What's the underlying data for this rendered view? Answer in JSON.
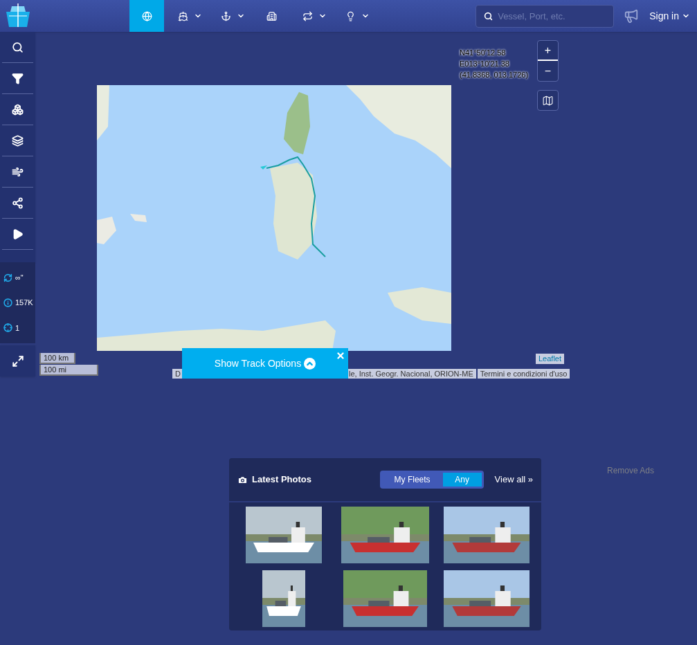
{
  "nav": {
    "tabs": [
      {
        "kind": "globe",
        "selected": true,
        "dropdown": false
      },
      {
        "kind": "ship",
        "selected": false,
        "dropdown": true
      },
      {
        "kind": "anchor",
        "selected": false,
        "dropdown": true
      },
      {
        "kind": "building",
        "selected": false,
        "dropdown": false
      },
      {
        "kind": "repeat",
        "selected": false,
        "dropdown": true
      },
      {
        "kind": "bulb",
        "selected": false,
        "dropdown": true
      }
    ]
  },
  "search": {
    "placeholder": "Vessel, Port, etc."
  },
  "sign_in": "Sign in",
  "sidebar": {
    "tools": [
      {
        "kind": "search"
      },
      {
        "kind": "filter"
      },
      {
        "kind": "boxes"
      },
      {
        "kind": "layers"
      },
      {
        "kind": "wind"
      },
      {
        "kind": "network"
      },
      {
        "kind": "play"
      }
    ],
    "stats": [
      {
        "kind": "refresh",
        "value": "∞\""
      },
      {
        "kind": "info",
        "value": "157K"
      },
      {
        "kind": "target",
        "value": "1"
      }
    ]
  },
  "map": {
    "coordinates": [
      "N41°50'12.58",
      "E013°10'21.38",
      "(41.8368, 013.1726)"
    ],
    "zoom_in": "+",
    "zoom_out": "−",
    "scale": [
      "100 km",
      "100 mi"
    ],
    "attribution": [
      "D",
      "le, Inst. Geogr. Nacional, ORION-ME",
      "Termini e condizioni d'uso"
    ],
    "leaflet": "Leaflet",
    "track_options": "Show Track Options"
  },
  "photos": {
    "title": "Latest Photos",
    "filters": [
      {
        "label": "My Fleets",
        "selected": false
      },
      {
        "label": "Any",
        "selected": true
      }
    ],
    "view_all": "View all »"
  },
  "remove_ads": "Remove Ads"
}
